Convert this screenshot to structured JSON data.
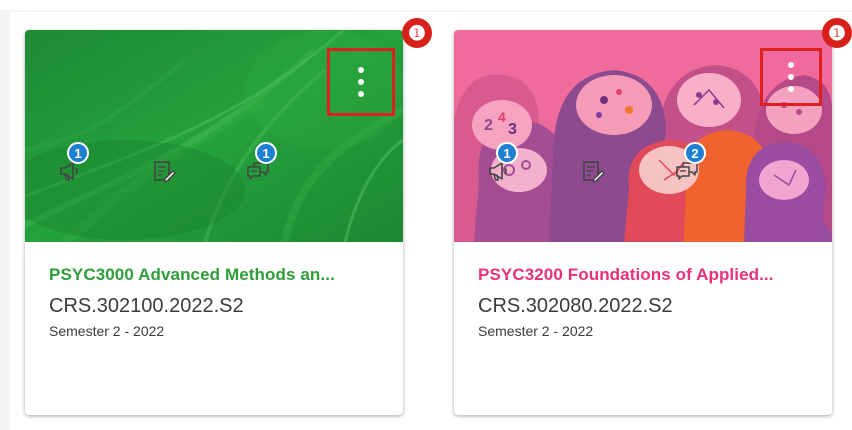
{
  "courses": [
    {
      "title": "PSYC3000 Advanced Methods an...",
      "code": "CRS.302100.2022.S2",
      "term": "Semester 2 - 2022",
      "title_color": "#2e9e3a",
      "badges": {
        "announcements": "1",
        "discussions": "1"
      },
      "image_style": "green-grass"
    },
    {
      "title": "PSYC3200 Foundations of Applied...",
      "code": "CRS.302080.2022.S2",
      "term": "Semester 2 - 2022",
      "title_color": "#e8317a",
      "badges": {
        "announcements": "1",
        "discussions": "2"
      },
      "image_style": "pink-heads-brains"
    }
  ],
  "callouts": [
    "❶",
    "❶"
  ],
  "icons": {
    "menu": "kebab-menu-icon",
    "announcements": "megaphone-icon",
    "assignments": "assignment-edit-icon",
    "discussions": "chat-bubbles-icon"
  },
  "colors": {
    "highlight_box": "#e0201f",
    "badge": "#1f7fd1",
    "callout": "#d8201a"
  }
}
